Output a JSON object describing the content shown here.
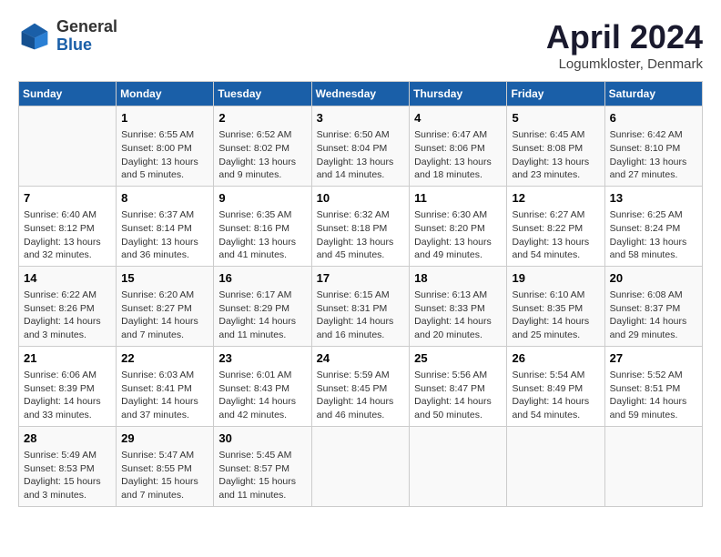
{
  "header": {
    "logo_general": "General",
    "logo_blue": "Blue",
    "month_title": "April 2024",
    "location": "Logumkloster, Denmark"
  },
  "days_of_week": [
    "Sunday",
    "Monday",
    "Tuesday",
    "Wednesday",
    "Thursday",
    "Friday",
    "Saturday"
  ],
  "weeks": [
    [
      {
        "day": "",
        "info": ""
      },
      {
        "day": "1",
        "info": "Sunrise: 6:55 AM\nSunset: 8:00 PM\nDaylight: 13 hours\nand 5 minutes."
      },
      {
        "day": "2",
        "info": "Sunrise: 6:52 AM\nSunset: 8:02 PM\nDaylight: 13 hours\nand 9 minutes."
      },
      {
        "day": "3",
        "info": "Sunrise: 6:50 AM\nSunset: 8:04 PM\nDaylight: 13 hours\nand 14 minutes."
      },
      {
        "day": "4",
        "info": "Sunrise: 6:47 AM\nSunset: 8:06 PM\nDaylight: 13 hours\nand 18 minutes."
      },
      {
        "day": "5",
        "info": "Sunrise: 6:45 AM\nSunset: 8:08 PM\nDaylight: 13 hours\nand 23 minutes."
      },
      {
        "day": "6",
        "info": "Sunrise: 6:42 AM\nSunset: 8:10 PM\nDaylight: 13 hours\nand 27 minutes."
      }
    ],
    [
      {
        "day": "7",
        "info": "Sunrise: 6:40 AM\nSunset: 8:12 PM\nDaylight: 13 hours\nand 32 minutes."
      },
      {
        "day": "8",
        "info": "Sunrise: 6:37 AM\nSunset: 8:14 PM\nDaylight: 13 hours\nand 36 minutes."
      },
      {
        "day": "9",
        "info": "Sunrise: 6:35 AM\nSunset: 8:16 PM\nDaylight: 13 hours\nand 41 minutes."
      },
      {
        "day": "10",
        "info": "Sunrise: 6:32 AM\nSunset: 8:18 PM\nDaylight: 13 hours\nand 45 minutes."
      },
      {
        "day": "11",
        "info": "Sunrise: 6:30 AM\nSunset: 8:20 PM\nDaylight: 13 hours\nand 49 minutes."
      },
      {
        "day": "12",
        "info": "Sunrise: 6:27 AM\nSunset: 8:22 PM\nDaylight: 13 hours\nand 54 minutes."
      },
      {
        "day": "13",
        "info": "Sunrise: 6:25 AM\nSunset: 8:24 PM\nDaylight: 13 hours\nand 58 minutes."
      }
    ],
    [
      {
        "day": "14",
        "info": "Sunrise: 6:22 AM\nSunset: 8:26 PM\nDaylight: 14 hours\nand 3 minutes."
      },
      {
        "day": "15",
        "info": "Sunrise: 6:20 AM\nSunset: 8:27 PM\nDaylight: 14 hours\nand 7 minutes."
      },
      {
        "day": "16",
        "info": "Sunrise: 6:17 AM\nSunset: 8:29 PM\nDaylight: 14 hours\nand 11 minutes."
      },
      {
        "day": "17",
        "info": "Sunrise: 6:15 AM\nSunset: 8:31 PM\nDaylight: 14 hours\nand 16 minutes."
      },
      {
        "day": "18",
        "info": "Sunrise: 6:13 AM\nSunset: 8:33 PM\nDaylight: 14 hours\nand 20 minutes."
      },
      {
        "day": "19",
        "info": "Sunrise: 6:10 AM\nSunset: 8:35 PM\nDaylight: 14 hours\nand 25 minutes."
      },
      {
        "day": "20",
        "info": "Sunrise: 6:08 AM\nSunset: 8:37 PM\nDaylight: 14 hours\nand 29 minutes."
      }
    ],
    [
      {
        "day": "21",
        "info": "Sunrise: 6:06 AM\nSunset: 8:39 PM\nDaylight: 14 hours\nand 33 minutes."
      },
      {
        "day": "22",
        "info": "Sunrise: 6:03 AM\nSunset: 8:41 PM\nDaylight: 14 hours\nand 37 minutes."
      },
      {
        "day": "23",
        "info": "Sunrise: 6:01 AM\nSunset: 8:43 PM\nDaylight: 14 hours\nand 42 minutes."
      },
      {
        "day": "24",
        "info": "Sunrise: 5:59 AM\nSunset: 8:45 PM\nDaylight: 14 hours\nand 46 minutes."
      },
      {
        "day": "25",
        "info": "Sunrise: 5:56 AM\nSunset: 8:47 PM\nDaylight: 14 hours\nand 50 minutes."
      },
      {
        "day": "26",
        "info": "Sunrise: 5:54 AM\nSunset: 8:49 PM\nDaylight: 14 hours\nand 54 minutes."
      },
      {
        "day": "27",
        "info": "Sunrise: 5:52 AM\nSunset: 8:51 PM\nDaylight: 14 hours\nand 59 minutes."
      }
    ],
    [
      {
        "day": "28",
        "info": "Sunrise: 5:49 AM\nSunset: 8:53 PM\nDaylight: 15 hours\nand 3 minutes."
      },
      {
        "day": "29",
        "info": "Sunrise: 5:47 AM\nSunset: 8:55 PM\nDaylight: 15 hours\nand 7 minutes."
      },
      {
        "day": "30",
        "info": "Sunrise: 5:45 AM\nSunset: 8:57 PM\nDaylight: 15 hours\nand 11 minutes."
      },
      {
        "day": "",
        "info": ""
      },
      {
        "day": "",
        "info": ""
      },
      {
        "day": "",
        "info": ""
      },
      {
        "day": "",
        "info": ""
      }
    ]
  ]
}
